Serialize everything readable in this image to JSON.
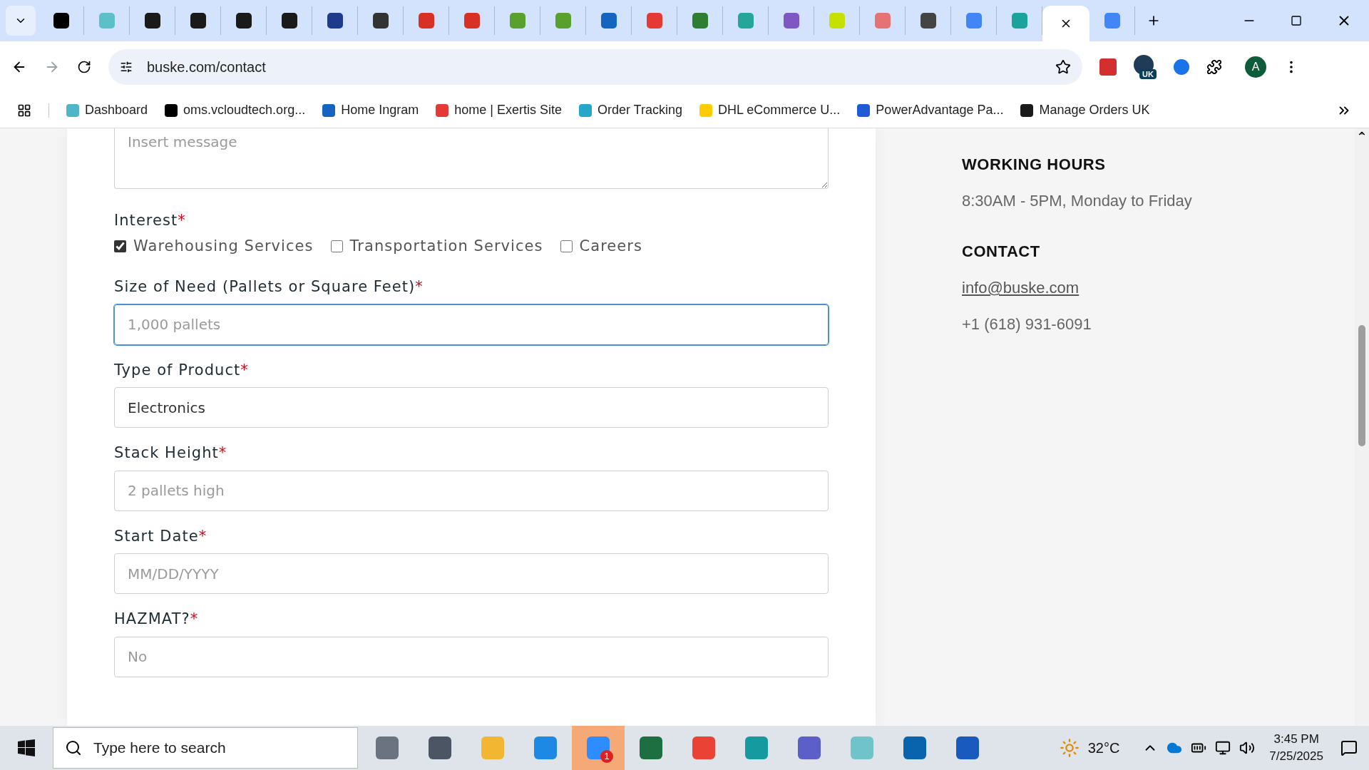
{
  "browser": {
    "tabs": [
      {
        "color": "#000000",
        "selected": false
      },
      {
        "color": "#5bc0c8",
        "selected": false
      },
      {
        "color": "#1a1a1a",
        "selected": false
      },
      {
        "color": "#1a1a1a",
        "selected": false
      },
      {
        "color": "#1a1a1a",
        "selected": false
      },
      {
        "color": "#1a1a1a",
        "selected": false
      },
      {
        "color": "#1e3a8a",
        "selected": false
      },
      {
        "color": "#333333",
        "selected": false
      },
      {
        "color": "#d93025",
        "selected": false
      },
      {
        "color": "#d93025",
        "selected": false
      },
      {
        "color": "#5aa02c",
        "selected": false
      },
      {
        "color": "#5aa02c",
        "selected": false
      },
      {
        "color": "#1565c0",
        "selected": false
      },
      {
        "color": "#e53935",
        "selected": false
      },
      {
        "color": "#2e7d32",
        "selected": false
      },
      {
        "color": "#26a69a",
        "selected": false
      },
      {
        "color": "#7e57c2",
        "selected": false
      },
      {
        "color": "#c6e000",
        "selected": false
      },
      {
        "color": "#e57373",
        "selected": false
      },
      {
        "color": "#444444",
        "selected": false
      },
      {
        "color": "#4285f4",
        "selected": false
      },
      {
        "color": "#1aa39a",
        "selected": false
      },
      {
        "selected": true
      },
      {
        "color": "#4285f4",
        "selected": false
      }
    ],
    "address": "buske.com/contact",
    "extension_badge": "UK",
    "profile_initial": "A",
    "bookmarks": [
      {
        "label": "Dashboard",
        "color": "#4fb6c9"
      },
      {
        "label": "oms.vcloudtech.org...",
        "color": "#000000"
      },
      {
        "label": "Home Ingram",
        "color": "#1565c0"
      },
      {
        "label": "home | Exertis Site",
        "color": "#e53935"
      },
      {
        "label": "Order Tracking",
        "color": "#26a6c9"
      },
      {
        "label": "DHL eCommerce U...",
        "color": "#ffcc00"
      },
      {
        "label": "PowerAdvantage Pa...",
        "color": "#1e5bd6"
      },
      {
        "label": "Manage Orders UK",
        "color": "#1a1a1a"
      }
    ]
  },
  "form": {
    "message": {
      "placeholder": "Insert message"
    },
    "interest": {
      "label": "Interest",
      "required": "*",
      "options": [
        {
          "label": "Warehousing Services",
          "checked": true
        },
        {
          "label": "Transportation Services",
          "checked": false
        },
        {
          "label": "Careers",
          "checked": false
        }
      ]
    },
    "fields": [
      {
        "label": "Size of Need (Pallets or Square Feet)",
        "required": "*",
        "placeholder": "1,000 pallets",
        "focused": true
      },
      {
        "label": "Type of Product",
        "required": "*",
        "value": "Electronics",
        "focused": false
      },
      {
        "label": "Stack Height",
        "required": "*",
        "placeholder": "2 pallets high",
        "focused": false
      },
      {
        "label": "Start Date",
        "required": "*",
        "placeholder": "MM/DD/YYYY",
        "focused": false
      },
      {
        "label": "HAZMAT?",
        "required": "*",
        "placeholder": "No",
        "focused": false
      }
    ]
  },
  "sidebar": {
    "sections": [
      {
        "heading": "WORKING HOURS",
        "lines": [
          {
            "kind": "text",
            "text": "8:30AM - 5PM, Monday to Friday"
          }
        ]
      },
      {
        "heading": "CONTACT",
        "lines": [
          {
            "kind": "link",
            "text": "info@buske.com"
          },
          {
            "kind": "text",
            "text": "+1 (618) 931-6091"
          }
        ]
      }
    ]
  },
  "taskbar": {
    "search_placeholder": "Type here to search",
    "apps": [
      {
        "color": "#6b7280",
        "selected": false
      },
      {
        "color": "#4b5563",
        "selected": false
      },
      {
        "color": "#f2b632",
        "selected": false
      },
      {
        "color": "#1e88e5",
        "selected": false
      },
      {
        "color": "#2d8cff",
        "selected": true,
        "badge": "1"
      },
      {
        "color": "#1d6f42",
        "selected": false
      },
      {
        "color": "#ea4335",
        "selected": false
      },
      {
        "color": "#159aa0",
        "selected": false
      },
      {
        "color": "#5b5fc7",
        "selected": false
      },
      {
        "color": "#6fc3c9",
        "selected": false
      },
      {
        "color": "#0a64ad",
        "selected": false
      },
      {
        "color": "#185abd",
        "selected": false
      }
    ],
    "temperature": "32°C",
    "time": "3:45 PM",
    "date": "7/25/2025"
  }
}
